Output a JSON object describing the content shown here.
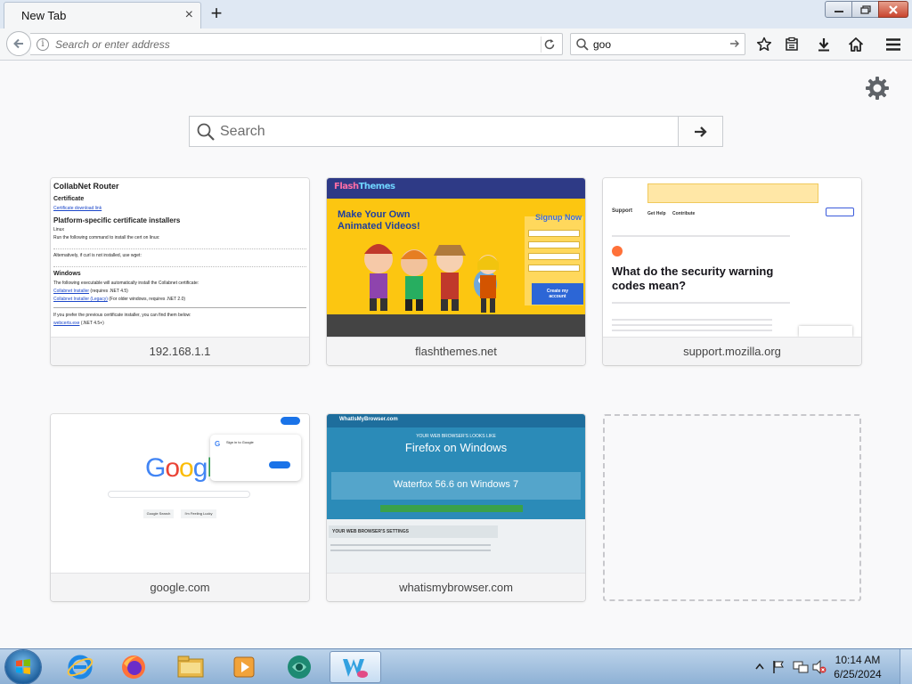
{
  "window": {
    "tab": {
      "title": "New Tab",
      "close_glyph": "×"
    },
    "new_tab_glyph": "+",
    "controls": [
      "minimize-icon",
      "restore-icon",
      "close-icon"
    ]
  },
  "navbar": {
    "url_placeholder": "Search or enter address",
    "search_value": "goo"
  },
  "newtab": {
    "search_placeholder": "Search",
    "tiles": [
      {
        "label": "192.168.1.1"
      },
      {
        "label": "flashthemes.net"
      },
      {
        "label": "support.mozilla.org"
      },
      {
        "label": "google.com"
      },
      {
        "label": "whatismybrowser.com"
      }
    ]
  },
  "thumbs": {
    "collabnet": {
      "title": "CollabNet Router",
      "certificate": "Certificate",
      "cert_link": "Certificate download link",
      "installers": "Platform-specific certificate installers",
      "linux": "Linux",
      "linux_text": "Run the following command to install the cert on linux:",
      "alt_text": "Alternatively, if curl is not installed, use wget:",
      "windows": "Windows",
      "win_text": "The following executable will automatically install the Collabnet certificate:",
      "win_link1": "Collabnet Installer",
      "win_link1_rest": "(requires .NET 4.5)",
      "win_link2": "Collabnet Installer (Legacy)",
      "win_link2_rest": "(For older windows, requires .NET 2.0)",
      "prev_text": "If you prefer the previous certificate installer, you can find them below:",
      "prev_link": "webcerts.exe",
      "prev_rest": "(.NET 4.5+)"
    },
    "flashthemes": {
      "logo_a": "Flash",
      "logo_b": "Themes",
      "headline_1": "Make Your Own",
      "headline_2": "Animated Videos!",
      "signup": "Signup Now",
      "cta_1": "Create my",
      "cta_2": "account"
    },
    "mozilla": {
      "support": "Support",
      "nav_1": "Get Help",
      "nav_2": "Contribute",
      "title": "What do the security warning codes mean?"
    },
    "google": {
      "logo": "Google",
      "popup_title": "Sign in to Google",
      "btn_1": "Google Search",
      "btn_2": "I'm Feeling Lucky"
    },
    "browser": {
      "site": "WhatIsMyBrowser.com",
      "line_1": "YOUR WEB BROWSER'S LOOKS LIKE",
      "line_2": "Firefox on Windows",
      "line_3": "Waterfox 56.6 on Windows 7",
      "settings": "YOUR WEB BROWSER'S SETTINGS"
    }
  },
  "taskbar": {
    "apps": [
      "internet-explorer-icon",
      "firefox-icon",
      "file-explorer-icon",
      "media-player-icon",
      "browser-app-icon",
      "waterfox-icon"
    ],
    "time": "10:14 AM",
    "date": "6/25/2024"
  },
  "colors": {
    "accent_blue": "#1e6e9d",
    "close_red": "#c9452e",
    "google_blue": "#4285f4",
    "google_red": "#ea4335",
    "google_yellow": "#fbbc05",
    "google_green": "#34a853"
  }
}
